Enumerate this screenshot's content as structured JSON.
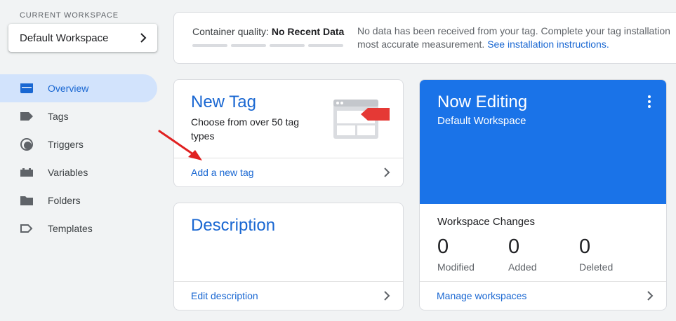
{
  "sidebar": {
    "workspace_label": "CURRENT WORKSPACE",
    "workspace_name": "Default Workspace",
    "items": [
      {
        "label": "Overview",
        "icon": "overview-icon",
        "active": true
      },
      {
        "label": "Tags",
        "icon": "tag-icon"
      },
      {
        "label": "Triggers",
        "icon": "trigger-icon"
      },
      {
        "label": "Variables",
        "icon": "variables-icon"
      },
      {
        "label": "Folders",
        "icon": "folder-icon"
      },
      {
        "label": "Templates",
        "icon": "template-icon"
      }
    ]
  },
  "quality": {
    "label": "Container quality:",
    "status": "No Recent Data",
    "message_line1": "No data has been received from your tag. Complete your tag installation",
    "message_line2": "most accurate measurement.",
    "link": "See installation instructions."
  },
  "new_tag": {
    "title": "New Tag",
    "subtitle": "Choose from over 50 tag types",
    "action": "Add a new tag"
  },
  "description": {
    "title": "Description",
    "action": "Edit description"
  },
  "now_editing": {
    "title": "Now Editing",
    "workspace": "Default Workspace",
    "changes_title": "Workspace Changes",
    "stats": [
      {
        "value": "0",
        "label": "Modified"
      },
      {
        "value": "0",
        "label": "Added"
      },
      {
        "value": "0",
        "label": "Deleted"
      }
    ],
    "action": "Manage workspaces"
  },
  "colors": {
    "accent": "#1a73e8",
    "link": "#1967d2",
    "active_nav_bg": "#d2e3fc",
    "annotation_arrow": "#e02020"
  }
}
